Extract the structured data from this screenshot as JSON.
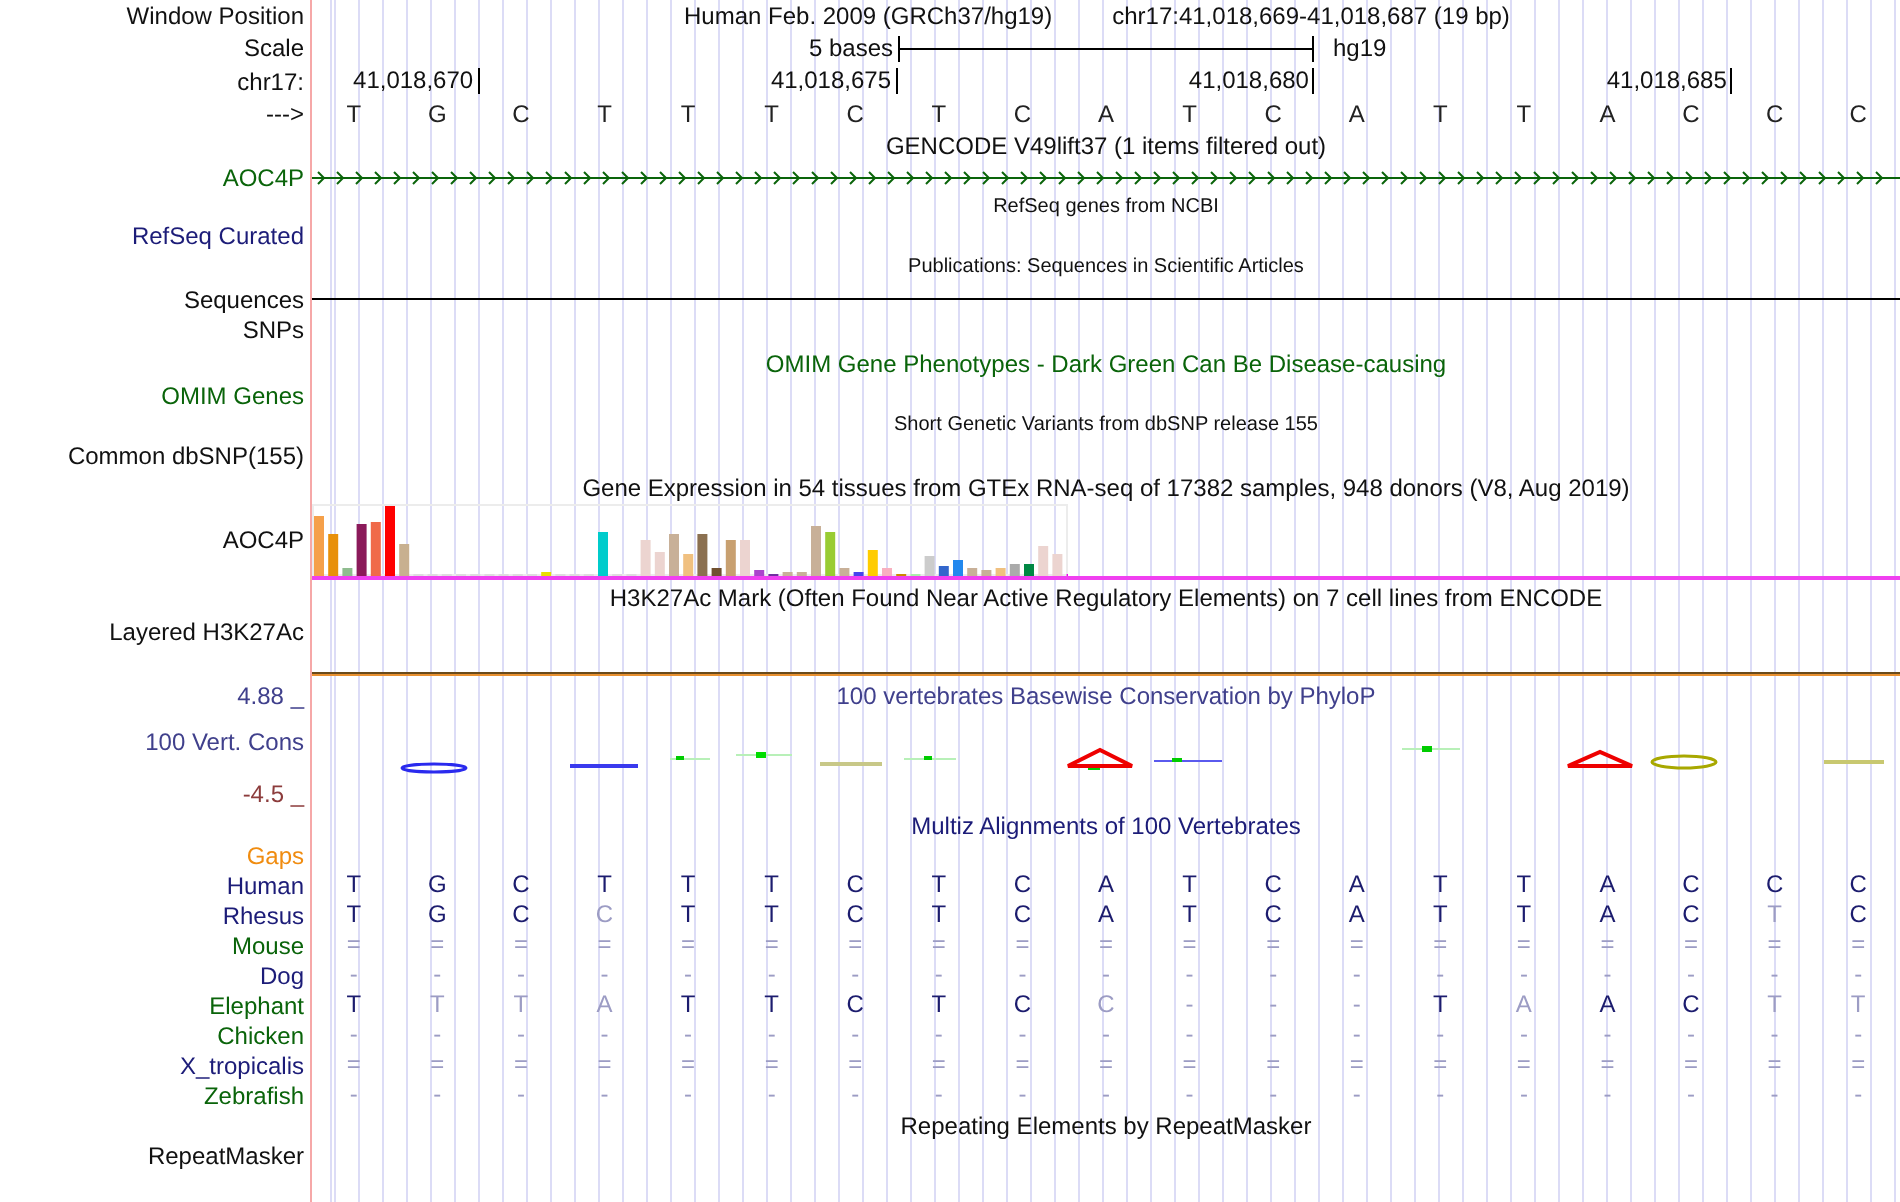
{
  "header": {
    "label": "Window Position",
    "assembly": "Human Feb. 2009 (GRCh37/hg19)",
    "position": "chr17:41,018,669-41,018,687 (19 bp)"
  },
  "scale": {
    "label": "Scale",
    "span": "5 bases",
    "assembly": "hg19"
  },
  "ruler": {
    "label": "chr17:",
    "ticks": [
      "41,018,670",
      "41,018,675",
      "41,018,680",
      "41,018,685"
    ]
  },
  "sequence": {
    "label": "--->",
    "bases": [
      "T",
      "G",
      "C",
      "T",
      "T",
      "T",
      "C",
      "T",
      "C",
      "A",
      "T",
      "C",
      "A",
      "T",
      "T",
      "A",
      "C",
      "C",
      "C"
    ]
  },
  "gencode": {
    "title": "GENCODE V49lift37 (1 items filtered out)",
    "gene": "AOC4P"
  },
  "refseq": {
    "title": "RefSeq genes from NCBI",
    "label": "RefSeq Curated"
  },
  "publications": {
    "title": "Publications: Sequences in Scientific Articles"
  },
  "sequences": {
    "label": "Sequences"
  },
  "snps": {
    "label": "SNPs"
  },
  "omim": {
    "title": "OMIM Gene Phenotypes - Dark Green Can Be Disease-causing",
    "label": "OMIM Genes"
  },
  "dbsnp": {
    "title": "Short Genetic Variants from dbSNP release 155",
    "label": "Common dbSNP(155)"
  },
  "gtex": {
    "title": "Gene Expression in 54 tissues from GTEx RNA-seq of 17382 samples, 948 donors (V8, Aug 2019)",
    "label": "AOC4P"
  },
  "h3k27ac": {
    "title": "H3K27Ac Mark (Often Found Near Active Regulatory Elements) on 7 cell lines from ENCODE",
    "label": "Layered H3K27Ac"
  },
  "conservation": {
    "title": "100 vertebrates Basewise Conservation by PhyloP",
    "label": "100 Vert. Cons",
    "max": "4.88 _",
    "min": "-4.5 _"
  },
  "multiz": {
    "title": "Multiz Alignments of 100 Vertebrates",
    "gaps_label": "Gaps",
    "species": [
      {
        "name": "Human",
        "color": "#1c1c78",
        "cells": [
          {
            "base": "T",
            "faded": false
          },
          {
            "base": "G",
            "faded": false
          },
          {
            "base": "C",
            "faded": false
          },
          {
            "base": "T",
            "faded": false
          },
          {
            "base": "T",
            "faded": false
          },
          {
            "base": "T",
            "faded": false
          },
          {
            "base": "C",
            "faded": false
          },
          {
            "base": "T",
            "faded": false
          },
          {
            "base": "C",
            "faded": false
          },
          {
            "base": "A",
            "faded": false
          },
          {
            "base": "T",
            "faded": false
          },
          {
            "base": "C",
            "faded": false
          },
          {
            "base": "A",
            "faded": false
          },
          {
            "base": "T",
            "faded": false
          },
          {
            "base": "T",
            "faded": false
          },
          {
            "base": "A",
            "faded": false
          },
          {
            "base": "C",
            "faded": false
          },
          {
            "base": "C",
            "faded": false
          },
          {
            "base": "C",
            "faded": false
          }
        ]
      },
      {
        "name": "Rhesus",
        "color": "#1c1c78",
        "cells": [
          {
            "base": "T",
            "faded": false
          },
          {
            "base": "G",
            "faded": false
          },
          {
            "base": "C",
            "faded": false
          },
          {
            "base": "C",
            "faded": true
          },
          {
            "base": "T",
            "faded": false
          },
          {
            "base": "T",
            "faded": false
          },
          {
            "base": "C",
            "faded": false
          },
          {
            "base": "T",
            "faded": false
          },
          {
            "base": "C",
            "faded": false
          },
          {
            "base": "A",
            "faded": false
          },
          {
            "base": "T",
            "faded": false
          },
          {
            "base": "C",
            "faded": false
          },
          {
            "base": "A",
            "faded": false
          },
          {
            "base": "T",
            "faded": false
          },
          {
            "base": "T",
            "faded": false
          },
          {
            "base": "A",
            "faded": false
          },
          {
            "base": "C",
            "faded": false
          },
          {
            "base": "T",
            "faded": true
          },
          {
            "base": "C",
            "faded": false
          }
        ]
      },
      {
        "name": "Mouse",
        "color": "#0a640a",
        "cells": [
          {
            "base": "=",
            "faded": true
          },
          {
            "base": "=",
            "faded": true
          },
          {
            "base": "=",
            "faded": true
          },
          {
            "base": "=",
            "faded": true
          },
          {
            "base": "=",
            "faded": true
          },
          {
            "base": "=",
            "faded": true
          },
          {
            "base": "=",
            "faded": true
          },
          {
            "base": "=",
            "faded": true
          },
          {
            "base": "=",
            "faded": true
          },
          {
            "base": "=",
            "faded": true
          },
          {
            "base": "=",
            "faded": true
          },
          {
            "base": "=",
            "faded": true
          },
          {
            "base": "=",
            "faded": true
          },
          {
            "base": "=",
            "faded": true
          },
          {
            "base": "=",
            "faded": true
          },
          {
            "base": "=",
            "faded": true
          },
          {
            "base": "=",
            "faded": true
          },
          {
            "base": "=",
            "faded": true
          },
          {
            "base": "=",
            "faded": true
          }
        ]
      },
      {
        "name": "Dog",
        "color": "#1c1c78",
        "cells": [
          {
            "base": "-",
            "faded": true
          },
          {
            "base": "-",
            "faded": true
          },
          {
            "base": "-",
            "faded": true
          },
          {
            "base": "-",
            "faded": true
          },
          {
            "base": "-",
            "faded": true
          },
          {
            "base": "-",
            "faded": true
          },
          {
            "base": "-",
            "faded": true
          },
          {
            "base": "-",
            "faded": true
          },
          {
            "base": "-",
            "faded": true
          },
          {
            "base": "-",
            "faded": true
          },
          {
            "base": "-",
            "faded": true
          },
          {
            "base": "-",
            "faded": true
          },
          {
            "base": "-",
            "faded": true
          },
          {
            "base": "-",
            "faded": true
          },
          {
            "base": "-",
            "faded": true
          },
          {
            "base": "-",
            "faded": true
          },
          {
            "base": "-",
            "faded": true
          },
          {
            "base": "-",
            "faded": true
          },
          {
            "base": "-",
            "faded": true
          }
        ]
      },
      {
        "name": "Elephant",
        "color": "#0a640a",
        "cells": [
          {
            "base": "T",
            "faded": false
          },
          {
            "base": "T",
            "faded": true
          },
          {
            "base": "T",
            "faded": true
          },
          {
            "base": "A",
            "faded": true
          },
          {
            "base": "T",
            "faded": false
          },
          {
            "base": "T",
            "faded": false
          },
          {
            "base": "C",
            "faded": false
          },
          {
            "base": "T",
            "faded": false
          },
          {
            "base": "C",
            "faded": false
          },
          {
            "base": "C",
            "faded": true
          },
          {
            "base": "-",
            "faded": true
          },
          {
            "base": "-",
            "faded": true
          },
          {
            "base": "-",
            "faded": true
          },
          {
            "base": "T",
            "faded": false
          },
          {
            "base": "A",
            "faded": true
          },
          {
            "base": "A",
            "faded": false
          },
          {
            "base": "C",
            "faded": false
          },
          {
            "base": "T",
            "faded": true
          },
          {
            "base": "T",
            "faded": true
          }
        ]
      },
      {
        "name": "Chicken",
        "color": "#0a640a",
        "cells": [
          {
            "base": "-",
            "faded": true
          },
          {
            "base": "-",
            "faded": true
          },
          {
            "base": "-",
            "faded": true
          },
          {
            "base": "-",
            "faded": true
          },
          {
            "base": "-",
            "faded": true
          },
          {
            "base": "-",
            "faded": true
          },
          {
            "base": "-",
            "faded": true
          },
          {
            "base": "-",
            "faded": true
          },
          {
            "base": "-",
            "faded": true
          },
          {
            "base": "-",
            "faded": true
          },
          {
            "base": "-",
            "faded": true
          },
          {
            "base": "-",
            "faded": true
          },
          {
            "base": "-",
            "faded": true
          },
          {
            "base": "-",
            "faded": true
          },
          {
            "base": "-",
            "faded": true
          },
          {
            "base": "-",
            "faded": true
          },
          {
            "base": "-",
            "faded": true
          },
          {
            "base": "-",
            "faded": true
          },
          {
            "base": "-",
            "faded": true
          }
        ]
      },
      {
        "name": "X_tropicalis",
        "color": "#1c1c78",
        "cells": [
          {
            "base": "=",
            "faded": true
          },
          {
            "base": "=",
            "faded": true
          },
          {
            "base": "=",
            "faded": true
          },
          {
            "base": "=",
            "faded": true
          },
          {
            "base": "=",
            "faded": true
          },
          {
            "base": "=",
            "faded": true
          },
          {
            "base": "=",
            "faded": true
          },
          {
            "base": "=",
            "faded": true
          },
          {
            "base": "=",
            "faded": true
          },
          {
            "base": "=",
            "faded": true
          },
          {
            "base": "=",
            "faded": true
          },
          {
            "base": "=",
            "faded": true
          },
          {
            "base": "=",
            "faded": true
          },
          {
            "base": "=",
            "faded": true
          },
          {
            "base": "=",
            "faded": true
          },
          {
            "base": "=",
            "faded": true
          },
          {
            "base": "=",
            "faded": true
          },
          {
            "base": "=",
            "faded": true
          },
          {
            "base": "=",
            "faded": true
          }
        ]
      },
      {
        "name": "Zebrafish",
        "color": "#0a640a",
        "cells": [
          {
            "base": "-",
            "faded": true
          },
          {
            "base": "-",
            "faded": true
          },
          {
            "base": "-",
            "faded": true
          },
          {
            "base": "-",
            "faded": true
          },
          {
            "base": "-",
            "faded": true
          },
          {
            "base": "-",
            "faded": true
          },
          {
            "base": "-",
            "faded": true
          },
          {
            "base": "-",
            "faded": true
          },
          {
            "base": "-",
            "faded": true
          },
          {
            "base": "-",
            "faded": true
          },
          {
            "base": "-",
            "faded": true
          },
          {
            "base": "-",
            "faded": true
          },
          {
            "base": "-",
            "faded": true
          },
          {
            "base": "-",
            "faded": true
          },
          {
            "base": "-",
            "faded": true
          },
          {
            "base": "-",
            "faded": true
          },
          {
            "base": "-",
            "faded": true
          },
          {
            "base": "-",
            "faded": true
          },
          {
            "base": "-",
            "faded": true
          }
        ]
      }
    ]
  },
  "repeatmasker": {
    "title": "Repeating Elements by RepeatMasker",
    "label": "RepeatMasker"
  }
}
